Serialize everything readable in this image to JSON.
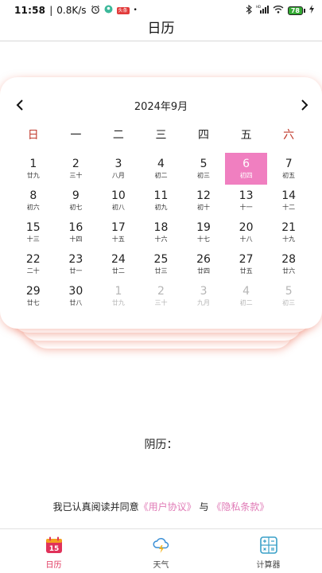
{
  "status_bar": {
    "time": "11:58",
    "speed": "0.8K/s",
    "badge": "头条",
    "battery": "78"
  },
  "header": {
    "title": "日历"
  },
  "calendar": {
    "month_title": "2024年9月",
    "prev_icon": "chevron-left-icon",
    "next_icon": "chevron-right-icon",
    "weekdays": [
      "日",
      "一",
      "二",
      "三",
      "四",
      "五",
      "六"
    ],
    "weeks": [
      [
        {
          "day": "1",
          "lunar": "廿九"
        },
        {
          "day": "2",
          "lunar": "三十"
        },
        {
          "day": "3",
          "lunar": "八月"
        },
        {
          "day": "4",
          "lunar": "初二"
        },
        {
          "day": "5",
          "lunar": "初三"
        },
        {
          "day": "6",
          "lunar": "初四",
          "selected": true
        },
        {
          "day": "7",
          "lunar": "初五"
        }
      ],
      [
        {
          "day": "8",
          "lunar": "初六"
        },
        {
          "day": "9",
          "lunar": "初七"
        },
        {
          "day": "10",
          "lunar": "初八"
        },
        {
          "day": "11",
          "lunar": "初九"
        },
        {
          "day": "12",
          "lunar": "初十"
        },
        {
          "day": "13",
          "lunar": "十一"
        },
        {
          "day": "14",
          "lunar": "十二"
        }
      ],
      [
        {
          "day": "15",
          "lunar": "十三"
        },
        {
          "day": "16",
          "lunar": "十四"
        },
        {
          "day": "17",
          "lunar": "十五"
        },
        {
          "day": "18",
          "lunar": "十六"
        },
        {
          "day": "19",
          "lunar": "十七"
        },
        {
          "day": "20",
          "lunar": "十八"
        },
        {
          "day": "21",
          "lunar": "十九"
        }
      ],
      [
        {
          "day": "22",
          "lunar": "二十"
        },
        {
          "day": "23",
          "lunar": "廿一"
        },
        {
          "day": "24",
          "lunar": "廿二"
        },
        {
          "day": "25",
          "lunar": "廿三"
        },
        {
          "day": "26",
          "lunar": "廿四"
        },
        {
          "day": "27",
          "lunar": "廿五"
        },
        {
          "day": "28",
          "lunar": "廿六"
        }
      ],
      [
        {
          "day": "29",
          "lunar": "廿七"
        },
        {
          "day": "30",
          "lunar": "廿八"
        },
        {
          "day": "1",
          "lunar": "廿九",
          "other": true
        },
        {
          "day": "2",
          "lunar": "三十",
          "other": true
        },
        {
          "day": "3",
          "lunar": "九月",
          "other": true
        },
        {
          "day": "4",
          "lunar": "初二",
          "other": true
        },
        {
          "day": "5",
          "lunar": "初三",
          "other": true
        }
      ]
    ]
  },
  "lunar_label": "阴历：",
  "agreement": {
    "prefix": "我已认真阅读并同意",
    "user_agreement": "《用户协议》",
    "conjunction": "与",
    "privacy_policy": "《隐私条款》"
  },
  "tabs": [
    {
      "label": "日历",
      "icon": "calendar-15-icon",
      "active": true
    },
    {
      "label": "天气",
      "icon": "weather-cloud-lightning-icon",
      "active": false
    },
    {
      "label": "计算器",
      "icon": "calculator-icon",
      "active": false
    }
  ],
  "colors": {
    "accent_pink": "#f07fc0",
    "weekend_red": "#c0392b",
    "link_pink": "#e07ab6",
    "active_tab_red": "#e0325a"
  }
}
